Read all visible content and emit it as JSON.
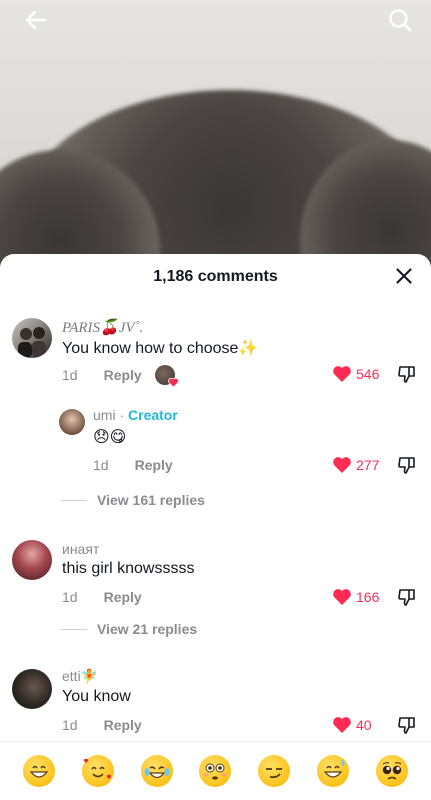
{
  "video": {
    "back_icon": "arrow-left-icon",
    "search_icon": "search-icon"
  },
  "sheet": {
    "title": "1,186 comments",
    "close_icon": "close-icon"
  },
  "comments": [
    {
      "name": "PARIS🍒JV˚.",
      "text": "You know how to choose✨",
      "time": "1d",
      "reply": "Reply",
      "likes": "546",
      "creator_liked": true
    },
    {
      "name": "umi",
      "creator_sep": " · ",
      "creator_label": "Creator",
      "text": "😞😋",
      "time": "1d",
      "reply": "Reply",
      "likes": "277"
    },
    {
      "name": "инаят",
      "text": "this girl knowsssss",
      "time": "1d",
      "reply": "Reply",
      "likes": "166"
    },
    {
      "name": "etti🧚",
      "text": "You know",
      "time": "1d",
      "reply": "Reply",
      "likes": "40"
    }
  ],
  "view_replies": [
    "View 161 replies",
    "View 21 replies"
  ],
  "colors": {
    "heart": "#fe2c55",
    "creator": "#20b8d8",
    "muted": "#8a8b91"
  },
  "emoji_bar": [
    "😁",
    "🥰",
    "😂",
    "😳",
    "😏",
    "😅",
    "🥺"
  ]
}
